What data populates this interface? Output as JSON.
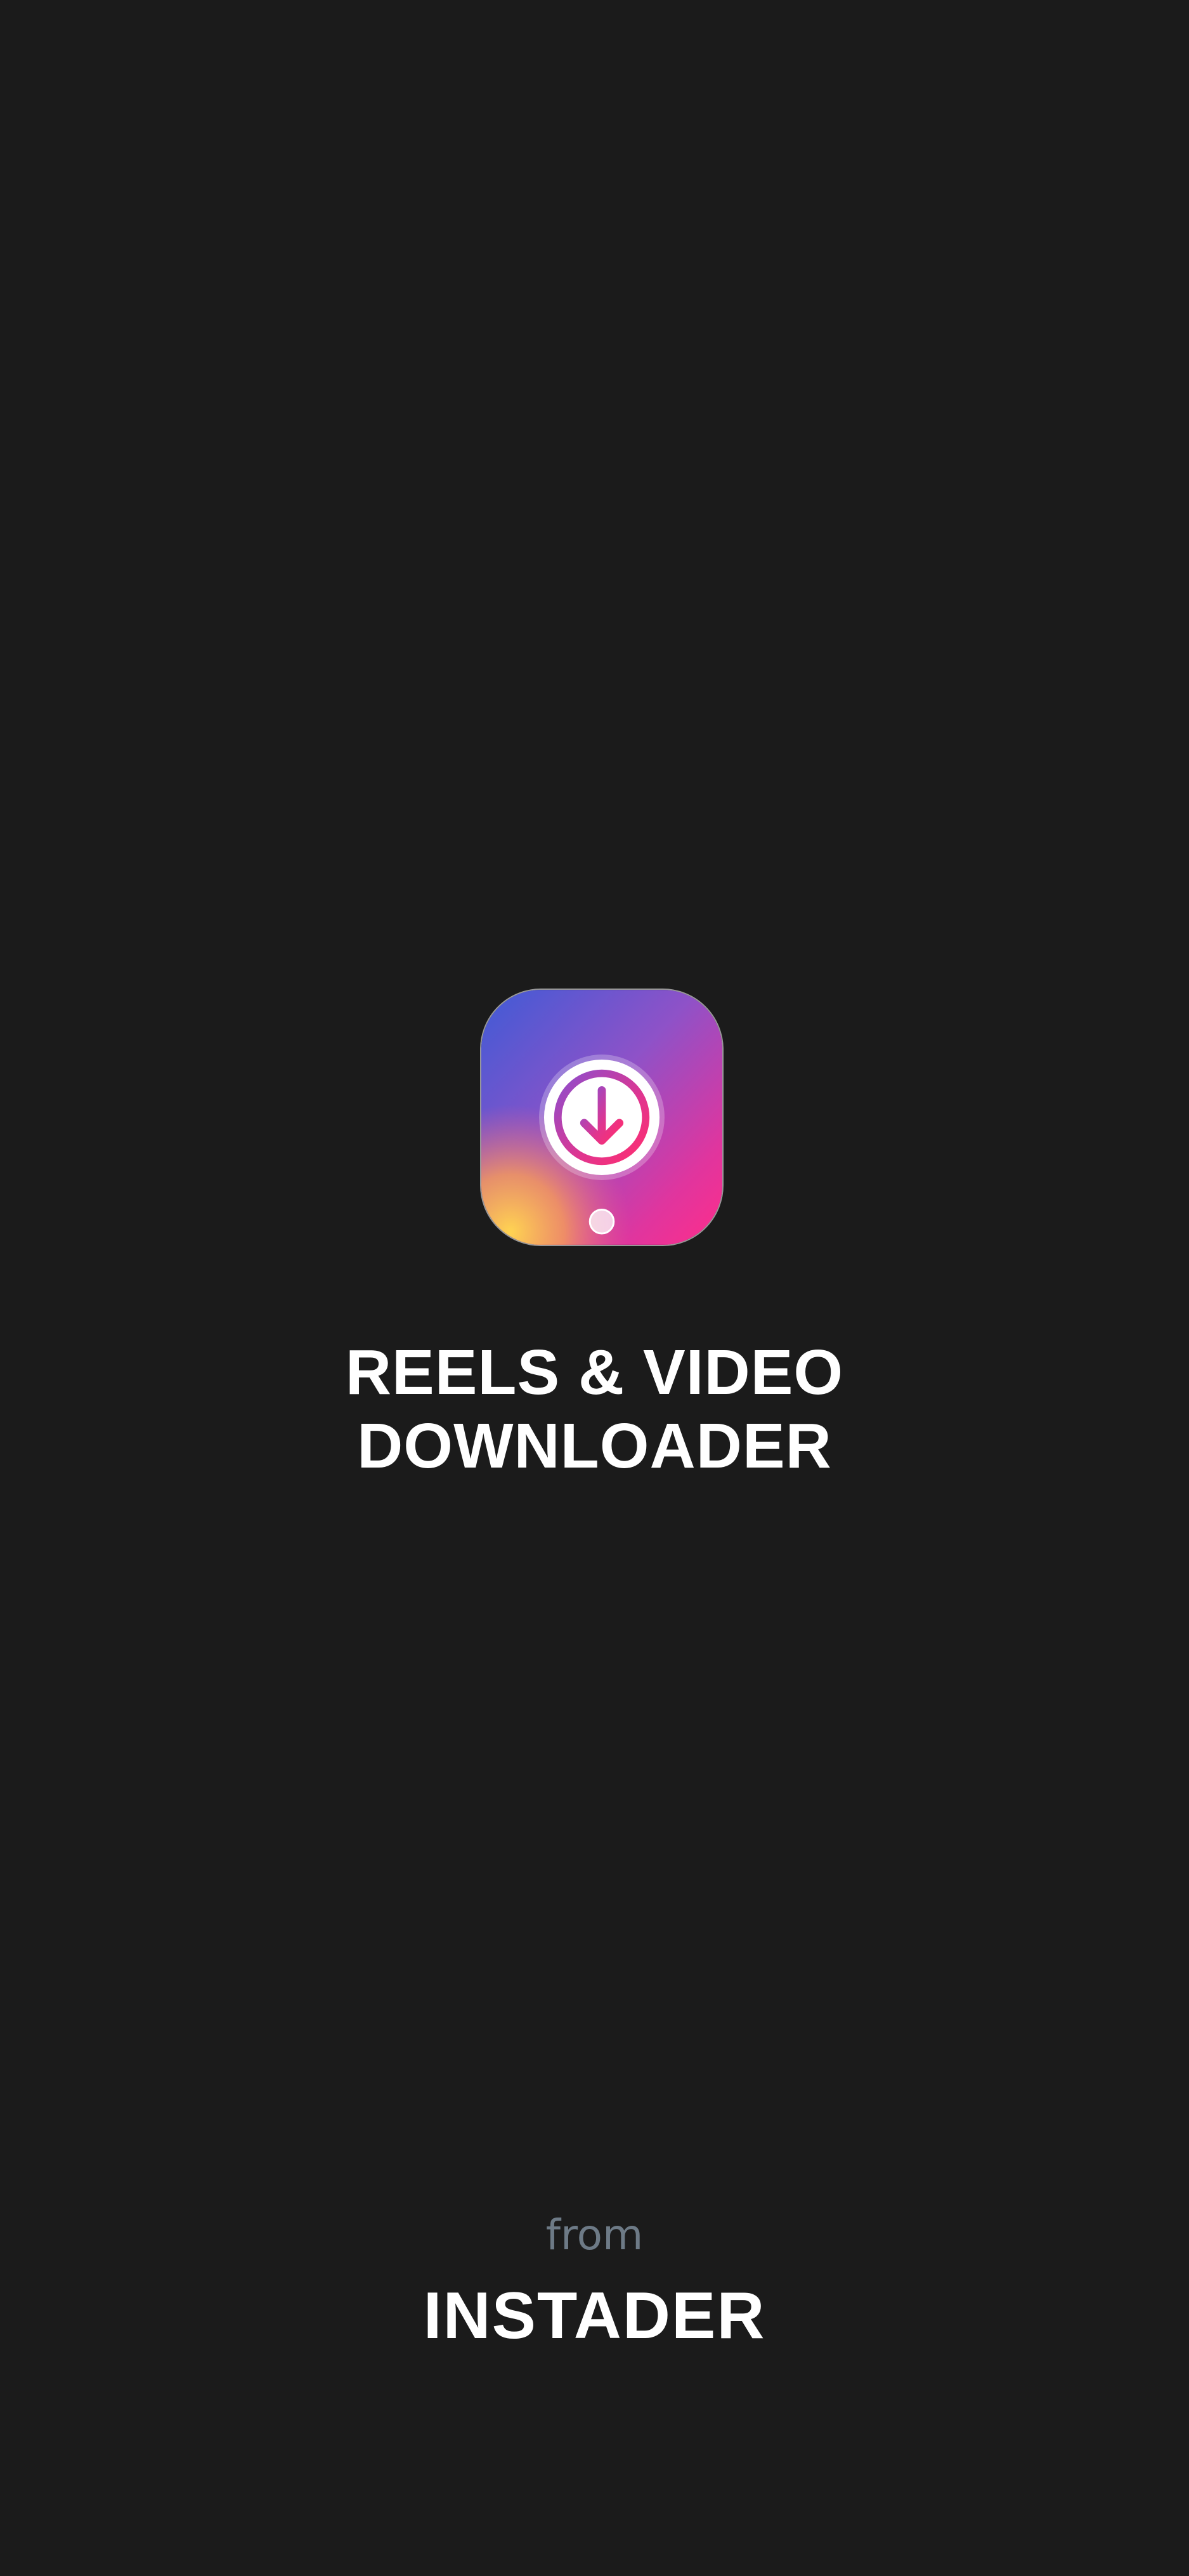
{
  "splash": {
    "app_icon": {
      "icon": "download-arrow-icon",
      "gradient_colors": [
        "#3f5bd6",
        "#8e52c8",
        "#e0359e",
        "#ff2d8a",
        "#f7c64a"
      ]
    },
    "title_line1": "REELS & VIDEO",
    "title_line2": "DOWNLOADER",
    "from_label": "from",
    "brand_name": "INSTADER"
  },
  "colors": {
    "background": "#1b1b1b",
    "title": "#ffffff",
    "from_label": "#6d7a86"
  }
}
